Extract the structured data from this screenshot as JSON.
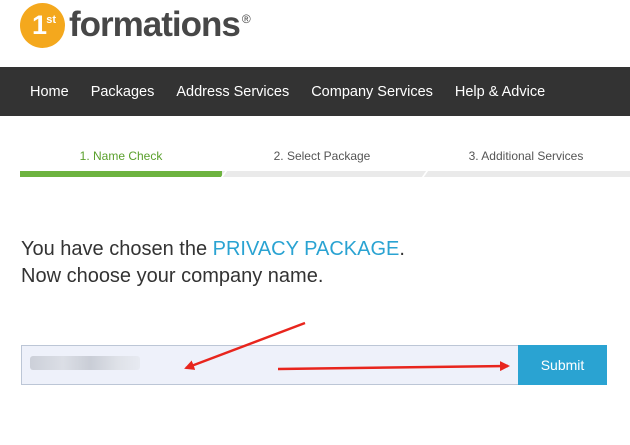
{
  "logo": {
    "number": "1",
    "superscript": "st",
    "wordmark": "formations",
    "registered": "®"
  },
  "nav": {
    "items": [
      "Home",
      "Packages",
      "Address Services",
      "Company Services",
      "Help & Advice"
    ]
  },
  "steps": [
    {
      "label": "1. Name Check",
      "active": true
    },
    {
      "label": "2. Select Package",
      "active": false
    },
    {
      "label": "3. Additional Services",
      "active": false
    }
  ],
  "headline": {
    "line1_prefix": "You have chosen the ",
    "package_name": "PRIVACY PACKAGE",
    "line1_suffix": ".",
    "line2": "Now choose your company name."
  },
  "company_name_field": {
    "value": "",
    "obscured": true
  },
  "submit": {
    "label": "Submit"
  },
  "colors": {
    "brand_orange": "#f4a81d",
    "nav_bg": "#333333",
    "step_active": "#6db33f",
    "link_blue": "#2aa3d2",
    "annotation_red": "#e8251d"
  }
}
